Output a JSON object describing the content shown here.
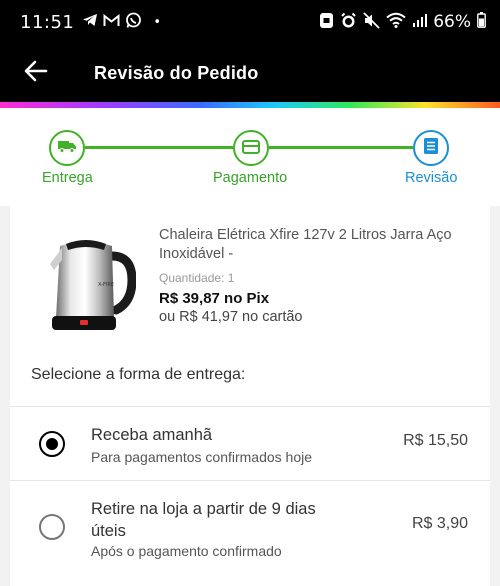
{
  "status_bar": {
    "time": "11:51",
    "dot": "•",
    "battery": "66%",
    "icons_left": [
      "telegram-icon",
      "gmail-icon",
      "whatsapp-icon"
    ],
    "icons_right": [
      "data-saver-icon",
      "alarm-icon",
      "mute-icon",
      "wifi-icon",
      "signal-icon",
      "battery-icon"
    ]
  },
  "app_bar": {
    "title": "Revisão do Pedido",
    "back_icon": "arrow-left-icon"
  },
  "stepper": {
    "accent_done": "#43b02a",
    "accent_active": "#1a8fd6",
    "steps": [
      {
        "label": "Entrega",
        "icon": "truck-icon",
        "state": "done"
      },
      {
        "label": "Pagamento",
        "icon": "card-icon",
        "state": "done"
      },
      {
        "label": "Revisão",
        "icon": "receipt-icon",
        "state": "active"
      }
    ]
  },
  "product": {
    "name": "Chaleira Elétrica Xfire 127v 2 Litros Jarra Aço Inoxidável -",
    "quantity": "Quantidade:  1",
    "price_pix": "R$ 39,87 no Pix",
    "price_card": "ou R$ 41,97 no cartão",
    "image_brand": "X-FIRE"
  },
  "delivery": {
    "title": "Selecione a forma de entrega:",
    "options": [
      {
        "title": "Receba amanhã",
        "subtitle": "Para pagamentos confirmados hoje",
        "price": "R$ 15,50",
        "selected": true
      },
      {
        "title": "Retire na loja a partir de 9 dias úteis",
        "subtitle": "Após o pagamento confirmado",
        "price": "R$ 3,90",
        "selected": false
      }
    ]
  }
}
